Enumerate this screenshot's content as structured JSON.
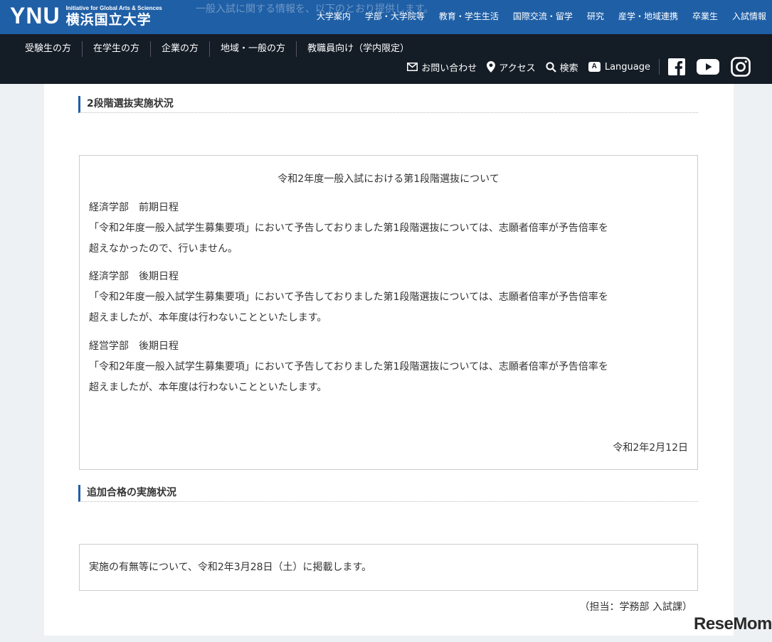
{
  "header": {
    "logo_text": "YNU",
    "logo_tagline": "Initiative for Global Arts & Sciences",
    "logo_jp": "横浜国立大学",
    "ghost_text": "一般入試に関する情報を、以下のとおり提供します。",
    "top_nav": [
      "大学案内",
      "学部・大学院等",
      "教育・学生生活",
      "国際交流・留学",
      "研究",
      "産学・地域連携",
      "卒業生",
      "入試情報"
    ],
    "audience_nav": [
      "受験生の方",
      "在学生の方",
      "企業の方",
      "地域・一般の方",
      "教職員向け（学内限定）"
    ],
    "utility": {
      "contact": "お問い合わせ",
      "access": "アクセス",
      "search": "検索",
      "lang_badge": "A",
      "language": "Language"
    }
  },
  "section1": {
    "heading": "2段階選抜実施状況",
    "box_title": "令和2年度一般入試における第1段階選抜について",
    "items": [
      {
        "faculty": "経済学部　前期日程",
        "line1": "「令和2年度一般入試学生募集要項」において予告しておりました第1段階選抜については、志願者倍率が予告倍率を",
        "line2": "超えなかったので、行いません。"
      },
      {
        "faculty": "経済学部　後期日程",
        "line1": "「令和2年度一般入試学生募集要項」において予告しておりました第1段階選抜については、志願者倍率が予告倍率を",
        "line2": "超えましたが、本年度は行わないことといたします。"
      },
      {
        "faculty": "経営学部　後期日程",
        "line1": "「令和2年度一般入試学生募集要項」において予告しておりました第1段階選抜については、志願者倍率が予告倍率を",
        "line2": "超えましたが、本年度は行わないことといたします。"
      }
    ],
    "date": "令和2年2月12日"
  },
  "section2": {
    "heading": "追加合格の実施状況",
    "text": "実施の有無等について、令和2年3月28日（土）に掲載します。"
  },
  "charge": "（担当：学務部 入試課）",
  "watermark": "ReseMom"
}
